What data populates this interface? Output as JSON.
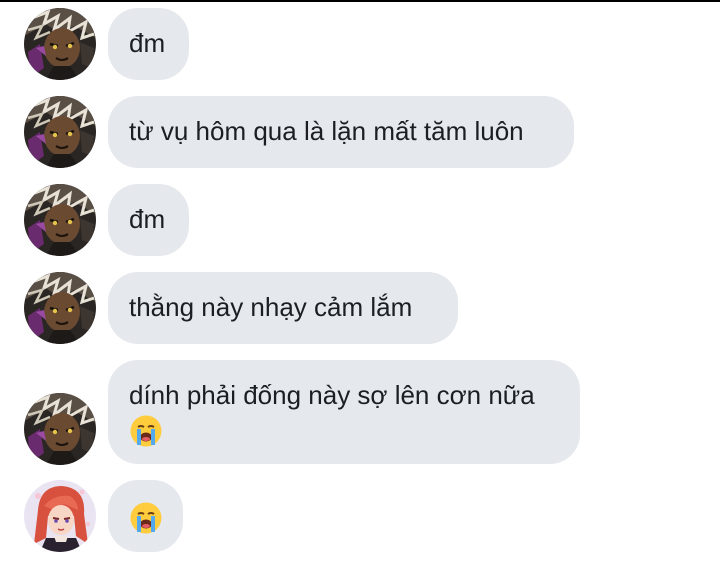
{
  "chat": {
    "messages": [
      {
        "sender": "friend",
        "text": "đm"
      },
      {
        "sender": "friend",
        "text": "từ vụ hôm qua là lặn mất tăm luôn"
      },
      {
        "sender": "friend",
        "text": "đm"
      },
      {
        "sender": "friend",
        "text": "thằng này nhạy cảm lắm"
      },
      {
        "sender": "friend",
        "text": "dính phải đống này sợ lên cơn nữa",
        "emoji": "loudly-crying-face"
      },
      {
        "sender": "me",
        "text": "",
        "emoji": "loudly-crying-face"
      }
    ]
  },
  "colors": {
    "bubble": "#e5e8ed",
    "text": "#1b1f24",
    "top_rule": "#000000"
  }
}
